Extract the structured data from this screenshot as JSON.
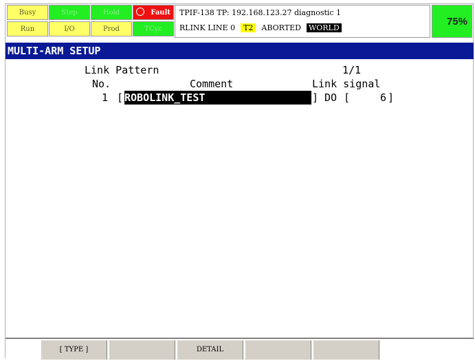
{
  "status_indicators": {
    "busy": "Busy",
    "step": "Step",
    "hold": "Hold",
    "fault": "Fault",
    "run": "Run",
    "io": "I/O",
    "prod": "Prod",
    "tcyc": "TCyc"
  },
  "info": {
    "line1": "TPIF-138 TP: 192.168.123.27 diagnostic 1",
    "program": "RLINK LINE 0",
    "mode": "T2",
    "state": "ABORTED",
    "coord": "WORLD"
  },
  "override": "75%",
  "title": "MULTI-ARM SETUP",
  "screen": {
    "heading": "Link Pattern",
    "page": "1/1",
    "col_no": "No.",
    "col_comment": "Comment",
    "col_signal": "Link signal",
    "rows": [
      {
        "no": "1",
        "comment": "ROBOLINK_TEST",
        "signal_type": "DO",
        "signal_index": "6"
      }
    ]
  },
  "softkeys": [
    "[ TYPE ]",
    "",
    "DETAIL",
    "",
    ""
  ],
  "colors": {
    "title_bg": "#0a1a96",
    "indicator_yellow": "#ffff66",
    "indicator_green": "#22ee22",
    "fault_red": "#ee1111"
  }
}
